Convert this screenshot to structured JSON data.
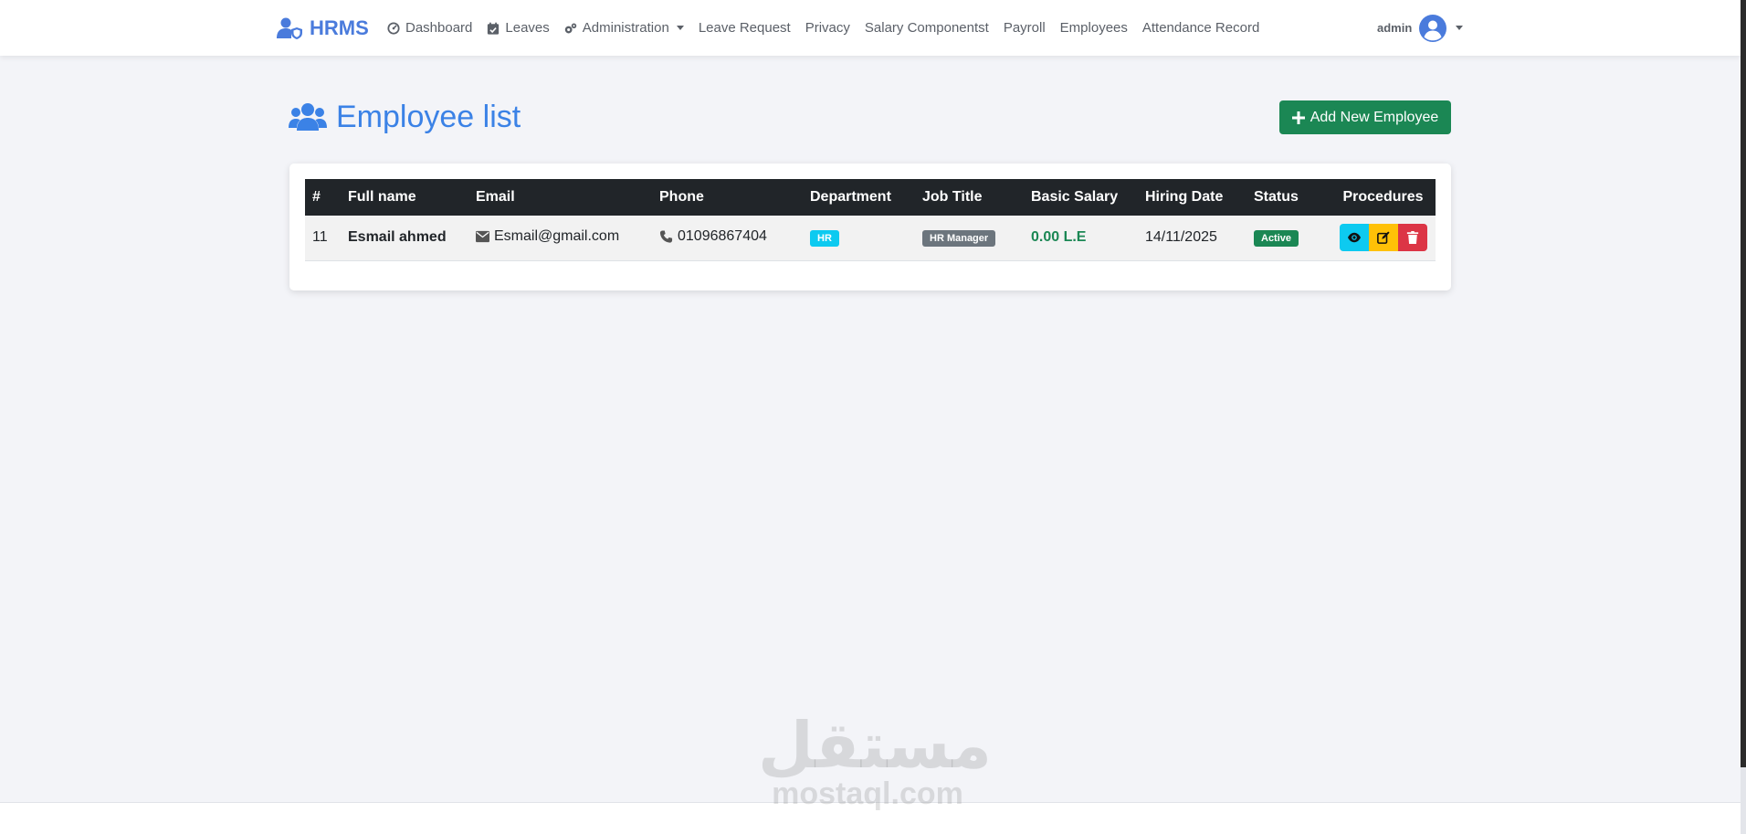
{
  "brand": {
    "name": "HRMS"
  },
  "nav": {
    "items": [
      {
        "label": "Dashboard",
        "icon": "dashboard-icon"
      },
      {
        "label": "Leaves",
        "icon": "calendar-check-icon"
      },
      {
        "label": "Administration",
        "icon": "gears-icon",
        "dropdown": true
      },
      {
        "label": "Leave Request"
      },
      {
        "label": "Privacy"
      },
      {
        "label": "Salary Componentst"
      },
      {
        "label": "Payroll"
      },
      {
        "label": "Employees"
      },
      {
        "label": "Attendance Record"
      }
    ]
  },
  "user": {
    "name": "admin"
  },
  "page": {
    "title": "Employee list",
    "add_button": "Add New Employee"
  },
  "table": {
    "headers": [
      "#",
      "Full name",
      "Email",
      "Phone",
      "Department",
      "Job Title",
      "Basic Salary",
      "Hiring Date",
      "Status",
      "Procedures"
    ],
    "rows": [
      {
        "id": "11",
        "full_name": "Esmail ahmed",
        "email": "Esmail@gmail.com",
        "phone": "01096867404",
        "department": "HR",
        "job_title": "HR Manager",
        "basic_salary": "0.00 L.E",
        "hiring_date": "14/11/2025",
        "status": "Active"
      }
    ]
  },
  "colors": {
    "brand": "#4a7bdc",
    "title": "#3b82e6",
    "success": "#1b8754",
    "info": "#0dcaf0",
    "warning": "#ffc107",
    "danger": "#dc3545",
    "secondary": "#6c757d",
    "dark": "#212529"
  },
  "watermark": {
    "logo": "مستقل",
    "text": "mostaql.com"
  }
}
